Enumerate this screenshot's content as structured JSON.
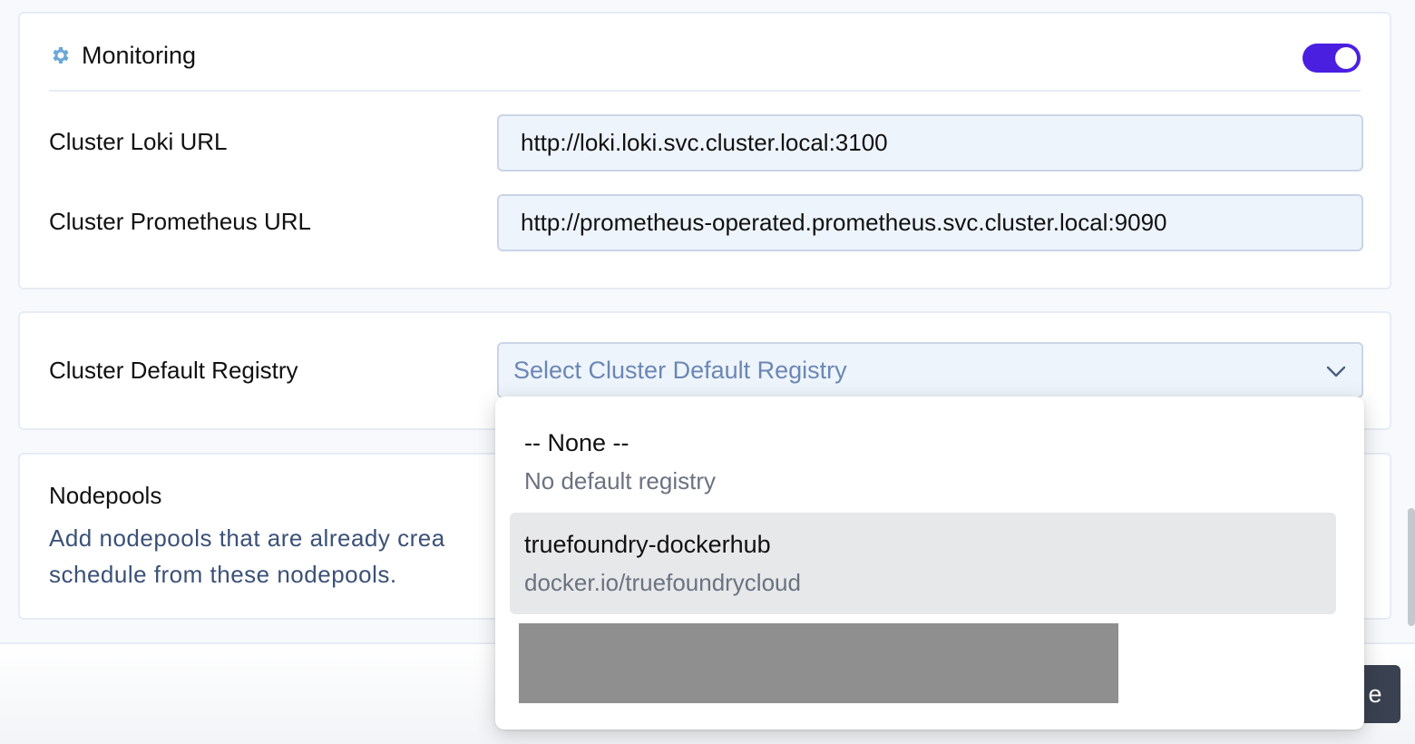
{
  "monitoring": {
    "title": "Monitoring",
    "enabled": true,
    "fields": [
      {
        "label": "Cluster Loki URL",
        "value": "http://loki.loki.svc.cluster.local:3100"
      },
      {
        "label": "Cluster Prometheus URL",
        "value": "http://prometheus-operated.prometheus.svc.cluster.local:9090"
      }
    ]
  },
  "registry": {
    "label": "Cluster Default Registry",
    "placeholder": "Select Cluster Default Registry",
    "options": [
      {
        "name": "-- None --",
        "description": "No default registry"
      },
      {
        "name": "truefoundry-dockerhub",
        "description": "docker.io/truefoundrycloud"
      }
    ]
  },
  "nodepools": {
    "title": "Nodepools",
    "description": "Add nodepools that are already crea\nschedule from these nodepools."
  },
  "footer": {
    "action_label_visible": "e"
  },
  "colors": {
    "accent": "#4a1fe0",
    "gear": "#6ba7d6",
    "input_bg": "#eef4fc"
  }
}
